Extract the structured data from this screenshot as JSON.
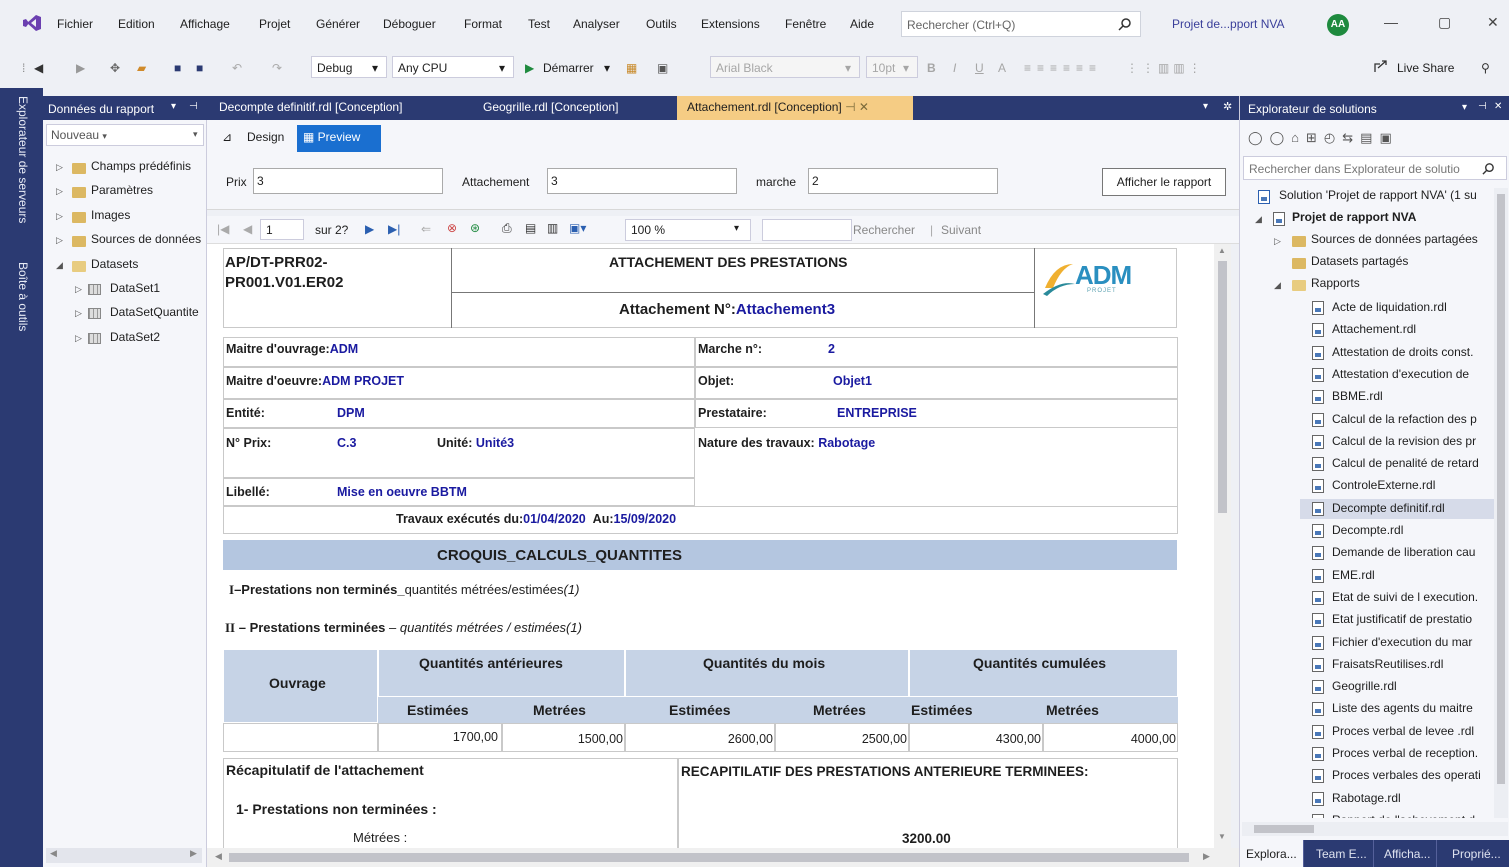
{
  "menu": {
    "items": [
      "Fichier",
      "Edition",
      "Affichage",
      "Projet",
      "Générer",
      "Déboguer",
      "Format",
      "Test",
      "Analyser",
      "Outils",
      "Extensions",
      "Fenêtre",
      "Aide"
    ],
    "search_placeholder": "Rechercher (Ctrl+Q)",
    "project_name": "Projet de...pport NVA",
    "user_initials": "AA"
  },
  "toolbar": {
    "config": "Debug",
    "platform": "Any CPU",
    "start_label": "Démarrer",
    "font_name": "Arial Black",
    "font_size": "10pt",
    "live_share": "Live Share"
  },
  "left_strip": {
    "server_explorer": "Explorateur de serveurs",
    "toolbox": "Boîte à outils"
  },
  "report_data_panel": {
    "title": "Données du rapport",
    "new_label": "Nouveau",
    "nodes": [
      {
        "label": "Champs prédéfinis",
        "kind": "folder"
      },
      {
        "label": "Paramètres",
        "kind": "folder"
      },
      {
        "label": "Images",
        "kind": "folder"
      },
      {
        "label": "Sources de données",
        "kind": "folder"
      },
      {
        "label": "Datasets",
        "kind": "folder-open"
      },
      {
        "label": "DataSet1",
        "kind": "dataset"
      },
      {
        "label": "DataSetQuantite",
        "kind": "dataset"
      },
      {
        "label": "DataSet2",
        "kind": "dataset"
      }
    ]
  },
  "doc_tabs": [
    {
      "label": "Decompte definitif.rdl [Conception]",
      "active": false
    },
    {
      "label": "Geogrille.rdl [Conception]",
      "active": false
    },
    {
      "label": "Attachement.rdl [Conception]",
      "active": true
    }
  ],
  "view_tabs": {
    "design": "Design",
    "preview": "Preview"
  },
  "params": {
    "prix_label": "Prix",
    "prix_value": "3",
    "attachement_label": "Attachement",
    "attachement_value": "3",
    "marche_label": "marche",
    "marche_value": "2",
    "show_report": "Afficher le rapport"
  },
  "nav": {
    "page": "1",
    "of": "sur 2?",
    "zoom": "100 %",
    "find": "Rechercher",
    "next": "Suivant"
  },
  "report": {
    "code": "AP/DT-PRR02-\nPR001.V01.ER02",
    "title": "ATTACHEMENT DES PRESTATIONS",
    "attach_label": "Attachement N°:",
    "attach_value": "Attachement3",
    "logo_text": "ADM",
    "logo_sub": "PROJET",
    "mo_label": "Maitre d'ouvrage:",
    "mo_value": "ADM",
    "moe_label": "Maitre d'oeuvre:",
    "moe_value": "ADM PROJET",
    "entite_label": "Entité:",
    "entite_value": "DPM",
    "prix_label": "N° Prix:",
    "prix_value": "C.3",
    "unite_label": "Unité:",
    "unite_value": "Unité3",
    "libelle_label": "Libellé:",
    "libelle_value": "Mise en oeuvre BBTM",
    "marche_label": "Marche n°:",
    "marche_value": "2",
    "objet_label": "Objet:",
    "objet_value": "Objet1",
    "prestataire_label": "Prestataire:",
    "prestataire_value": "ENTREPRISE",
    "nature_label": "Nature des travaux:",
    "nature_value": "Rabotage",
    "travaux_label": "Travaux exécutés du:",
    "date_from": "01/04/2020",
    "au_label": "Au:",
    "date_to": "15/09/2020",
    "section_title": "CROQUIS_CALCULS_QUANTITES",
    "line1_num": "I",
    "line1_bold": "–Prestations non terminés_",
    "line1_normal": "quantités métrées/estimées",
    "line1_note": "(1)",
    "line2_num": "II",
    "line2_bold": " – Prestations terminées ",
    "line2_italic": "– quantités métrées / estimées(1)",
    "table": {
      "ouvrage": "Ouvrage",
      "groups": [
        "Quantités antérieures",
        "Quantités du mois",
        "Quantités cumulées"
      ],
      "subs": [
        "Estimées",
        "Metrées",
        "Estimées",
        "Metrées",
        "Estimées",
        "Metrées"
      ],
      "values": [
        "1700,00",
        "1500,00",
        "2600,00",
        "2500,00",
        "4300,00",
        "4000,00"
      ]
    },
    "recap_title": "Récapitulatif de l'attachement",
    "recap_right": "RECAPITILATIF DES PRESTATIONS ANTERIEURE TERMINEES:",
    "recap_item1": "1- Prestations non terminées :",
    "recap_metrees": "Métrées :",
    "recap_value": "3200.00"
  },
  "solution_explorer": {
    "title": "Explorateur de solutions",
    "search_placeholder": "Rechercher dans Explorateur de solutio",
    "solution_label": "Solution 'Projet de rapport NVA' (1 su",
    "project_label": "Projet de rapport NVA",
    "shared_sources": "Sources de données partagées",
    "shared_datasets": "Datasets partagés",
    "reports_folder": "Rapports",
    "reports": [
      "Acte de liquidation.rdl",
      "Attachement.rdl",
      "Attestation de droits const.",
      "Attestation d'execution de",
      "BBME.rdl",
      "Calcul de la refaction des p",
      "Calcul de la revision des pr",
      "Calcul de penalité de retard",
      "ControleExterne.rdl",
      "Decompte definitif.rdl",
      "Decompte.rdl",
      "Demande de liberation cau",
      "EME.rdl",
      "Etat de suivi de l execution.",
      "Etat justificatif de prestatio",
      "Fichier d'execution du mar",
      "FraisatsReutilises.rdl",
      "Geogrille.rdl",
      "Liste des agents du maitre",
      "Proces verbal de levee .rdl",
      "Proces verbal de reception.",
      "Proces verbales des operati",
      "Rabotage.rdl",
      "Rapport de l'achevement d"
    ],
    "selected": "Decompte definitif.rdl",
    "bottom_tabs": [
      "Explora...",
      "Team E...",
      "Afficha...",
      "Proprié..."
    ]
  },
  "colors": {
    "accent": "#2b3a72",
    "active_tab": "#f5cc84",
    "report_blue": "#1a1aa0",
    "table_header": "#c6d3e6",
    "section_band": "#b4c6e0"
  }
}
